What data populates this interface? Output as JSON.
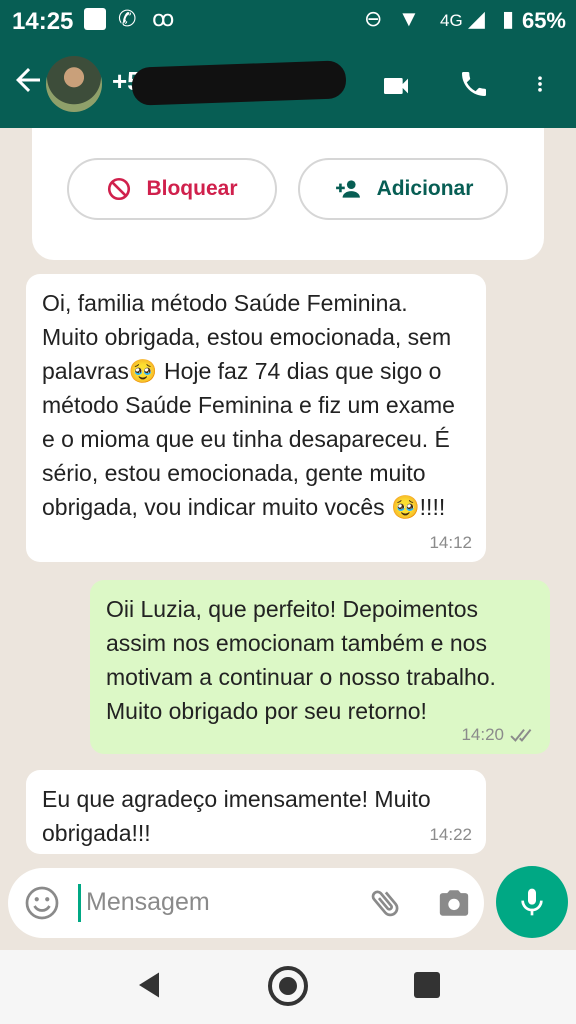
{
  "status": {
    "time": "14:25",
    "network": "4G",
    "battery": "65%"
  },
  "header": {
    "contact_visible": "+5",
    "redacted": true,
    "icons": [
      "back-arrow-icon",
      "video-call-icon",
      "phone-icon",
      "more-vert-icon"
    ]
  },
  "actions": {
    "block_label": "Bloquear",
    "add_label": "Adicionar"
  },
  "messages": [
    {
      "direction": "in",
      "text": "Oi, familia método Saúde Feminina. Muito obrigada, estou emocionada, sem palavras🥹 Hoje faz 74 dias que sigo o método Saúde Feminina e fiz um exame e o mioma que eu tinha desapareceu. É sério, estou emocionada, gente muito obrigada, vou indicar muito vocês 🥹!!!!",
      "time": "14:12"
    },
    {
      "direction": "out",
      "text": "Oii Luzia, que perfeito! Depoimentos assim nos emocionam também e nos motivam a continuar o nosso trabalho. Muito obrigado por seu retorno!",
      "time": "14:20",
      "status": "read"
    },
    {
      "direction": "in",
      "text": "Eu que agradeço imensamente! Muito obrigada!!!",
      "time": "14:22"
    }
  ],
  "composer": {
    "placeholder": "Mensagem"
  },
  "colors": {
    "header": "#075e54",
    "accent": "#00a884",
    "outgoing_bubble": "#dcf8c6",
    "chat_background": "#ece5dd",
    "block_red": "#d0204c"
  }
}
